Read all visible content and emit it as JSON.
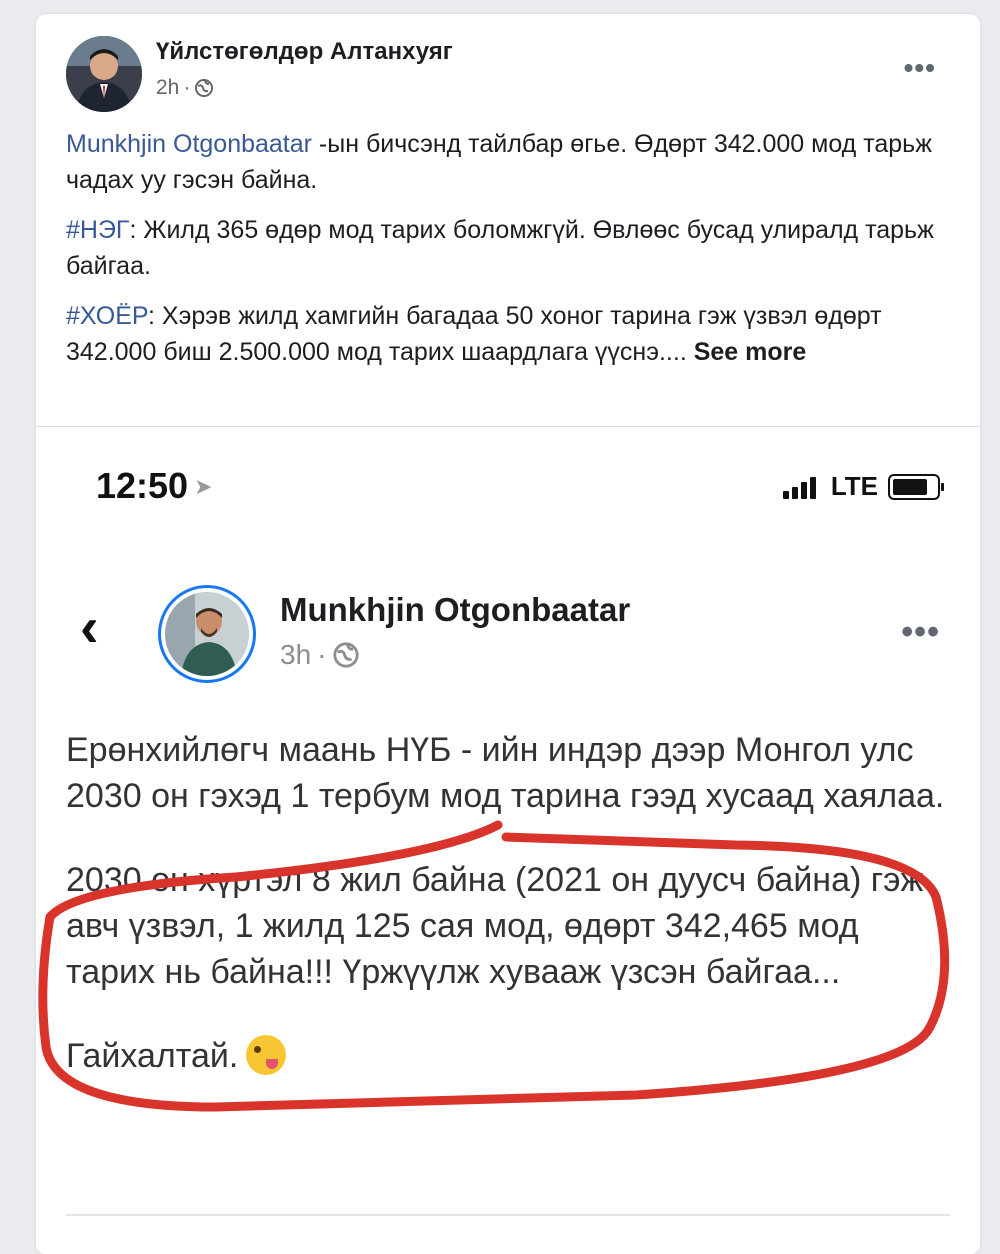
{
  "post": {
    "author": "Үйлстөгөлдөр Алтанхуяг",
    "time": "2h",
    "paragraphs": [
      {
        "link": "Munkhjin Otgonbaatar",
        "text": " -ын бичсэнд тайлбар өгье. Өдөрт 342.000 мод тарьж чадах уу гэсэн байна."
      },
      {
        "link": "#НЭГ",
        "text": ": Жилд 365 өдөр мод тарих боломжгүй. Өвлөөс бусад улиралд тарьж байгаа."
      },
      {
        "link": "#ХОЁР",
        "text": ": Хэрэв жилд хамгийн багадаа 50 хоног тарина гэж үзвэл өдөрт 342.000 биш 2.500.000 мод тарих шаардлага үүснэ.... "
      }
    ],
    "see_more": "See more"
  },
  "shared": {
    "status_time": "12:50",
    "network": "LTE",
    "author": "Munkhjin Otgonbaatar",
    "time": "3h",
    "paragraphs": [
      "Ерөнхийлөгч маань НҮБ - ийн индэр дээр Монгол улс 2030 он гэхэд 1 тербум мод тарина гээд хусаад хаялаа.",
      "2030 он хүртэл 8 жил байна (2021 он дуусч байна) гэж авч үзвэл, 1 жилд 125 сая мод, өдөрт 342,465 мод тарих нь байна!!! Үржүүлж хувааж үзсэн байгаа...",
      "Гайхалтай."
    ]
  },
  "colors": {
    "link": "#385898",
    "annotation": "#d9342b"
  }
}
